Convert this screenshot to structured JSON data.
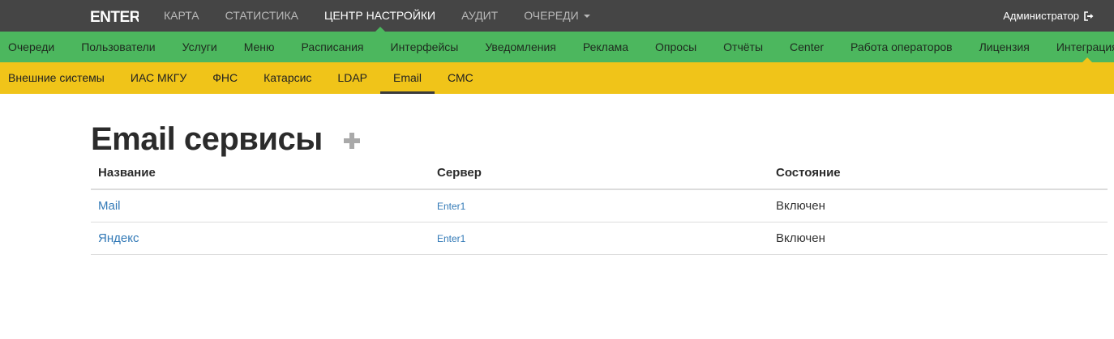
{
  "brand": {
    "logo_text": "ENTER"
  },
  "topnav": {
    "items": [
      {
        "label": "КАРТА",
        "active": false
      },
      {
        "label": "СТАТИСТИКА",
        "active": false
      },
      {
        "label": "ЦЕНТР НАСТРОЙКИ",
        "active": true
      },
      {
        "label": "АУДИТ",
        "active": false
      },
      {
        "label": "ОЧЕРЕДИ",
        "active": false,
        "dropdown": true
      }
    ],
    "user_label": "Администратор",
    "logout_icon": "logout-icon"
  },
  "greennav": {
    "items": [
      {
        "label": "Очереди"
      },
      {
        "label": "Пользователи"
      },
      {
        "label": "Услуги"
      },
      {
        "label": "Меню"
      },
      {
        "label": "Расписания"
      },
      {
        "label": "Интерфейсы"
      },
      {
        "label": "Уведомления"
      },
      {
        "label": "Реклама"
      },
      {
        "label": "Опросы"
      },
      {
        "label": "Отчёты"
      },
      {
        "label": "Center"
      },
      {
        "label": "Работа операторов"
      },
      {
        "label": "Лицензия"
      },
      {
        "label": "Интеграция",
        "active": true
      }
    ]
  },
  "subnav": {
    "items": [
      {
        "label": "Внешние системы"
      },
      {
        "label": "ИАС МКГУ"
      },
      {
        "label": "ФНС"
      },
      {
        "label": "Катарсис"
      },
      {
        "label": "LDAP"
      },
      {
        "label": "Email",
        "active": true
      },
      {
        "label": "СМС"
      }
    ]
  },
  "main": {
    "title": "Email сервисы",
    "add_icon": "plus-icon",
    "table": {
      "headers": [
        "Название",
        "Сервер",
        "Состояние"
      ],
      "rows": [
        {
          "name": "Mail",
          "server": "Enter1",
          "state": "Включен"
        },
        {
          "name": "Яндекс",
          "server": "Enter1",
          "state": "Включен"
        }
      ]
    }
  },
  "colors": {
    "topbar": "#454545",
    "green": "#4cb75e",
    "yellow": "#f0c419",
    "link": "#337ab7"
  }
}
